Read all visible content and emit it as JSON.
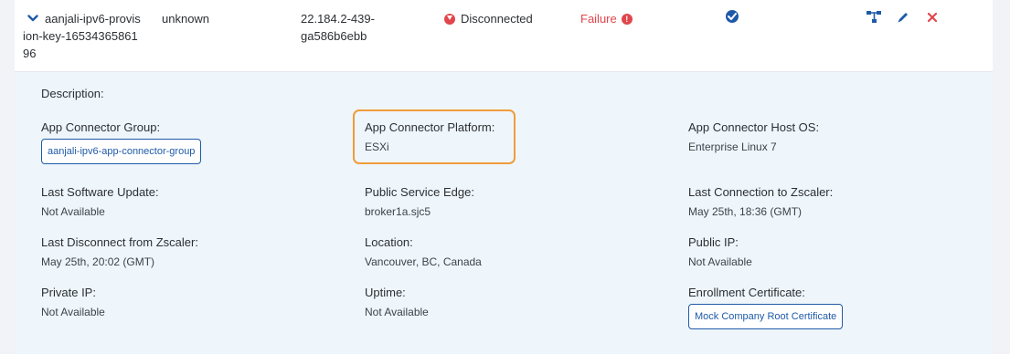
{
  "row": {
    "name": "aanjali-ipv6-provision-key-1653436586196",
    "auth_state": "unknown",
    "version": "22.184.2-439-ga586b6ebb",
    "status": "Disconnected",
    "result": "Failure"
  },
  "details": {
    "description_label": "Description:",
    "group_label": "App Connector Group:",
    "group_value": "aanjali-ipv6-app-connector-group",
    "platform_label": "App Connector Platform:",
    "platform_value": "ESXi",
    "host_os_label": "App Connector Host OS:",
    "host_os_value": "Enterprise Linux 7",
    "last_sw_update_label": "Last Software Update:",
    "last_sw_update_value": "Not Available",
    "public_edge_label": "Public Service Edge:",
    "public_edge_value": "broker1a.sjc5",
    "last_conn_label": "Last Connection to Zscaler:",
    "last_conn_value": "May 25th, 18:36 (GMT)",
    "last_disconnect_label": "Last Disconnect from Zscaler:",
    "last_disconnect_value": "May 25th, 20:02 (GMT)",
    "location_label": "Location:",
    "location_value": "Vancouver, BC, Canada",
    "public_ip_label": "Public IP:",
    "public_ip_value": "Not Available",
    "private_ip_label": "Private IP:",
    "private_ip_value": "Not Available",
    "uptime_label": "Uptime:",
    "uptime_value": "Not Available",
    "enrollment_cert_label": "Enrollment Certificate:",
    "enrollment_cert_value": "Mock Company Root Certificate"
  },
  "colors": {
    "accent": "#1f5aa8",
    "danger": "#e0474c",
    "highlight": "#f19b3b",
    "details_bg": "#eef6fc"
  },
  "icons": [
    "chevron-down-icon",
    "disconnected-icon",
    "failure-alert-icon",
    "check-circle-icon",
    "topology-icon",
    "edit-icon",
    "delete-icon"
  ]
}
